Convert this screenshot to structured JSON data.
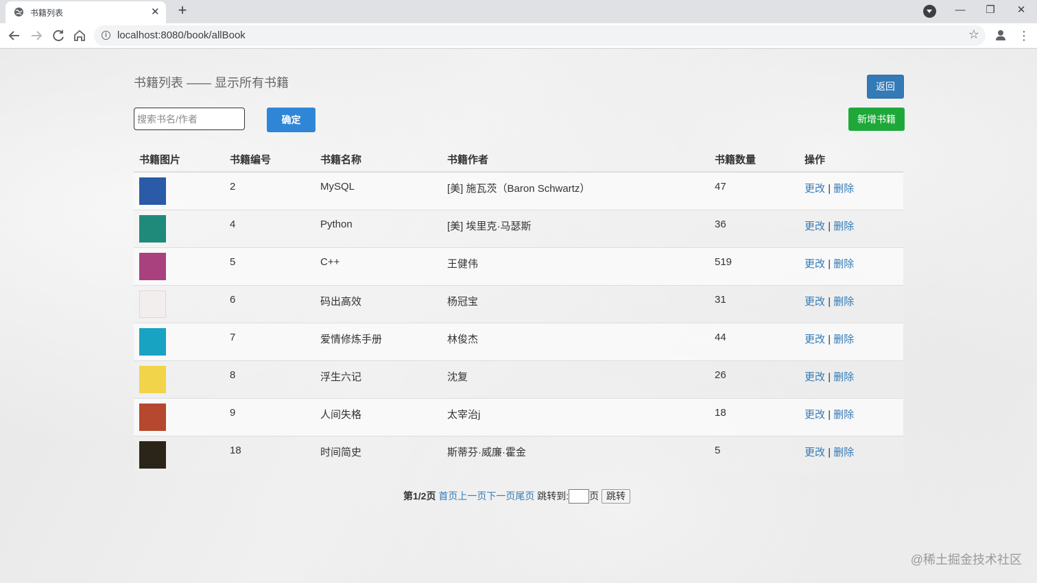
{
  "browser": {
    "tab_title": "书籍列表",
    "tab_close": "✕",
    "new_tab": "+",
    "url": "localhost:8080/book/allBook",
    "window_controls": {
      "minimize": "—",
      "restore": "❐",
      "close": "✕"
    }
  },
  "page": {
    "title": "书籍列表 —— 显示所有书籍",
    "back_label": "返回",
    "search_placeholder": "搜索书名/作者",
    "confirm_label": "确定",
    "add_label": "新增书籍"
  },
  "table": {
    "headers": [
      "书籍图片",
      "书籍编号",
      "书籍名称",
      "书籍作者",
      "书籍数量",
      "操作"
    ],
    "edit_label": "更改",
    "separator": "|",
    "delete_label": "删除",
    "rows": [
      {
        "id": "2",
        "name": "MySQL",
        "author": "[美] 施瓦茨（Baron Schwartz）",
        "count": "47",
        "cover_color": "#2a5aa8"
      },
      {
        "id": "4",
        "name": "Python",
        "author": "[美] 埃里克·马瑟斯",
        "count": "36",
        "cover_color": "#1f8a7a"
      },
      {
        "id": "5",
        "name": "C++",
        "author": "王健伟",
        "count": "519",
        "cover_color": "#a8417e"
      },
      {
        "id": "6",
        "name": "码出高效",
        "author": "杨冠宝",
        "count": "31",
        "cover_color": "#f3eeee"
      },
      {
        "id": "7",
        "name": "爱情修炼手册",
        "author": "林俊杰",
        "count": "44",
        "cover_color": "#19a3c2"
      },
      {
        "id": "8",
        "name": "浮生六记",
        "author": "沈复",
        "count": "26",
        "cover_color": "#f1d44a"
      },
      {
        "id": "9",
        "name": "人间失格",
        "author": "太宰治j",
        "count": "18",
        "cover_color": "#b5482f"
      },
      {
        "id": "18",
        "name": "时间简史",
        "author": "斯蒂芬·威廉·霍金",
        "count": "5",
        "cover_color": "#2b2418"
      }
    ]
  },
  "pager": {
    "current": "第1/2页",
    "first": "首页",
    "prev": "上一页",
    "next": "下一页",
    "last": "尾页",
    "jump_to": "跳转到:",
    "page_unit": "页",
    "go": "跳转"
  },
  "watermark": "@稀土掘金技术社区"
}
